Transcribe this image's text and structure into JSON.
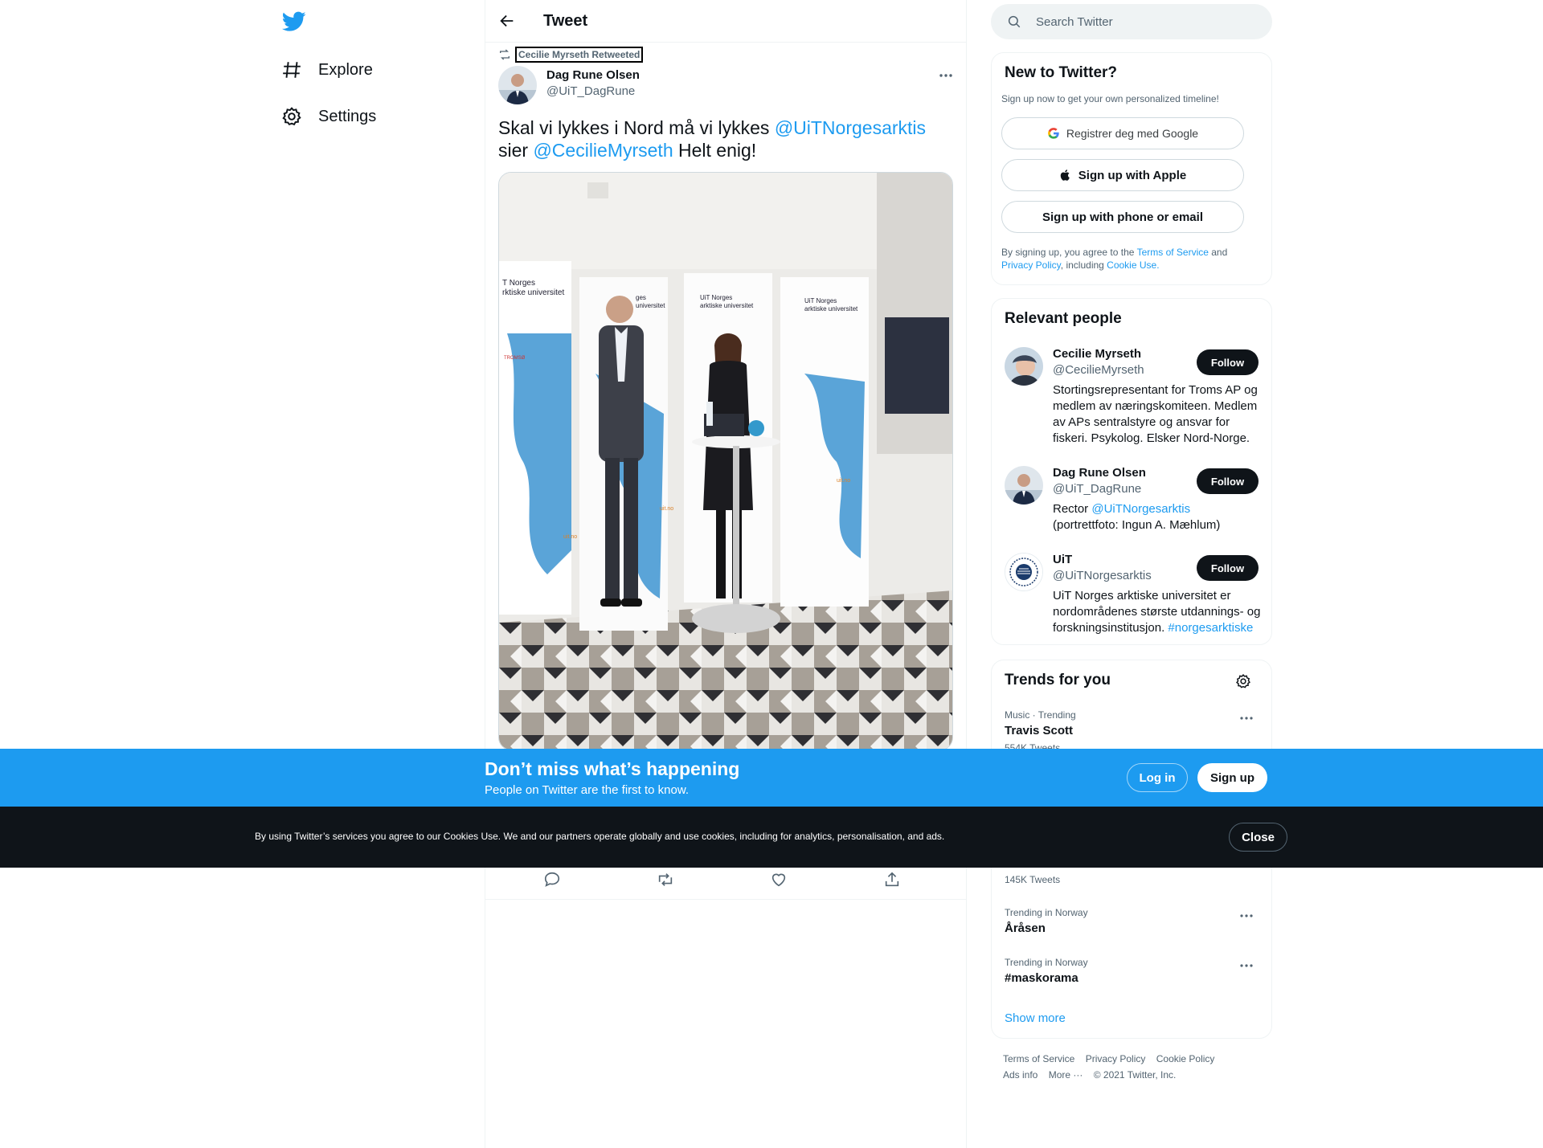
{
  "nav": {
    "items": [
      {
        "label": "Explore",
        "icon": "hashtag-icon"
      },
      {
        "label": "Settings",
        "icon": "gear-icon"
      }
    ]
  },
  "header": {
    "title": "Tweet"
  },
  "tweet": {
    "retweeted_by": "Cecilie Myrseth Retweeted",
    "author_name": "Dag Rune Olsen",
    "author_handle": "@UiT_DagRune",
    "text_1": "Skal vi lykkes i Nord må vi lykkes ",
    "mention_1": "@UiTNorgesarktis",
    "text_2": " sier ",
    "mention_2": "@CecilieMyrseth",
    "text_3": " Helt enig!",
    "media_signs": {
      "sign_1a": "T Norges",
      "sign_1b": "rktiske universitet",
      "sign_2a": "UiT Norges",
      "sign_2b": "arktiske universitet",
      "sign_3a": "UiT Norges",
      "sign_3b": "arktiske universitet",
      "sign_4a": "ges",
      "sign_4b": "universitet",
      "sign_5": "TROMSØ",
      "sign_6": "uit.no",
      "sign_7": "uit.no",
      "sign_8": "uit.no"
    }
  },
  "search": {
    "placeholder": "Search Twitter"
  },
  "signup_card": {
    "title": "New to Twitter?",
    "subtitle": "Sign up now to get your own personalized timeline!",
    "google_label": "Registrer deg med Google",
    "apple_label": "Sign up with Apple",
    "phone_label": "Sign up with phone or email",
    "legal_1": "By signing up, you agree to the ",
    "terms": "Terms of Service",
    "legal_2": " and ",
    "privacy": "Privacy Policy",
    "legal_3": ", including ",
    "cookie": "Cookie Use."
  },
  "relevant": {
    "title": "Relevant people",
    "people": [
      {
        "name": "Cecilie Myrseth",
        "handle": "@CecilieMyrseth",
        "bio": "Stortingsrepresentant for Troms AP og medlem av næringskomiteen. Medlem av APs sentralstyre og ansvar for fiskeri. Psykolog. Elsker Nord-Norge.",
        "follow": "Follow"
      },
      {
        "name": "Dag Rune Olsen",
        "handle": "@UiT_DagRune",
        "bio_1": "Rector ",
        "bio_link": "@UiTNorgesarktis",
        "bio_2": "(portrettfoto: Ingun A. Mæhlum)",
        "follow": "Follow"
      },
      {
        "name": "UiT",
        "handle": "@UiTNorgesarktis",
        "bio_1": "UiT Norges arktiske universitet er nordområdenes største utdannings- og forskningsinstitusjon. ",
        "bio_link": "#norgesarktiske",
        "follow": "Follow"
      }
    ]
  },
  "trends": {
    "title": "Trends for you",
    "items": [
      {
        "meta": "Music · Trending",
        "name": "Travis Scott",
        "count": "554K Tweets"
      },
      {
        "count": "145K Tweets"
      },
      {
        "meta": "Trending in Norway",
        "name": "Åråsen"
      },
      {
        "meta": "Trending in Norway",
        "name": "#maskorama"
      }
    ],
    "show_more": "Show more"
  },
  "footer": {
    "terms": "Terms of Service",
    "privacy": "Privacy Policy",
    "cookie": "Cookie Policy",
    "ads": "Ads info",
    "more": "More ···",
    "copyright": "© 2021 Twitter, Inc."
  },
  "banner": {
    "title": "Don’t miss what’s happening",
    "subtitle": "People on Twitter are the first to know.",
    "login": "Log in",
    "signup": "Sign up"
  },
  "cookie_bar": {
    "text": "By using Twitter’s services you agree to our Cookies Use. We and our partners operate globally and use cookies, including for analytics, personalisation, and ads.",
    "close": "Close"
  },
  "colors": {
    "accent": "#1d9bf0",
    "dark": "#0f1419",
    "muted": "#536471",
    "border": "#eff3f4"
  }
}
